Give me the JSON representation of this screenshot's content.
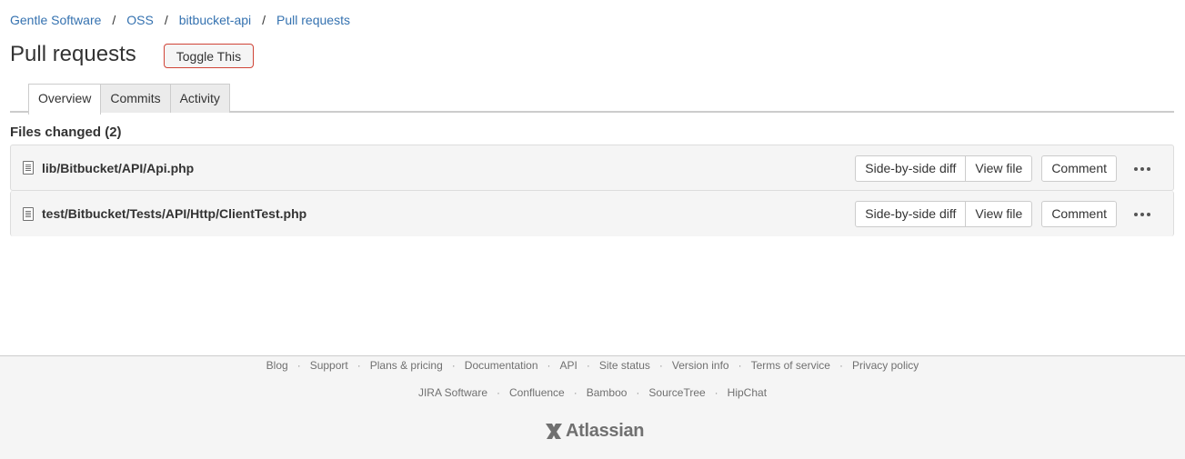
{
  "breadcrumb": {
    "items": [
      "Gentle Software",
      "OSS",
      "bitbucket-api",
      "Pull requests"
    ],
    "separator": "/"
  },
  "header": {
    "title": "Pull requests",
    "toggle_label": "Toggle This"
  },
  "tabs": [
    {
      "label": "Overview",
      "active": true
    },
    {
      "label": "Commits",
      "active": false
    },
    {
      "label": "Activity",
      "active": false
    }
  ],
  "files": {
    "heading": "Files changed (2)",
    "rows": [
      {
        "path": "lib/Bitbucket/API/Api.php",
        "icon": "file-icon",
        "side_by_side_label": "Side-by-side diff",
        "view_file_label": "View file",
        "comment_label": "Comment"
      },
      {
        "path": "test/Bitbucket/Tests/API/Http/ClientTest.php",
        "icon": "file-icon",
        "side_by_side_label": "Side-by-side diff",
        "view_file_label": "View file",
        "comment_label": "Comment"
      }
    ]
  },
  "footer": {
    "links_row1": [
      "Blog",
      "Support",
      "Plans & pricing",
      "Documentation",
      "API",
      "Site status",
      "Version info",
      "Terms of service",
      "Privacy policy"
    ],
    "links_row2": [
      "JIRA Software",
      "Confluence",
      "Bamboo",
      "SourceTree",
      "HipChat"
    ],
    "logo_text": "Atlassian"
  },
  "colors": {
    "link": "#3572b0",
    "toggle_border": "#d04437",
    "footer_bg": "#f5f5f5"
  }
}
